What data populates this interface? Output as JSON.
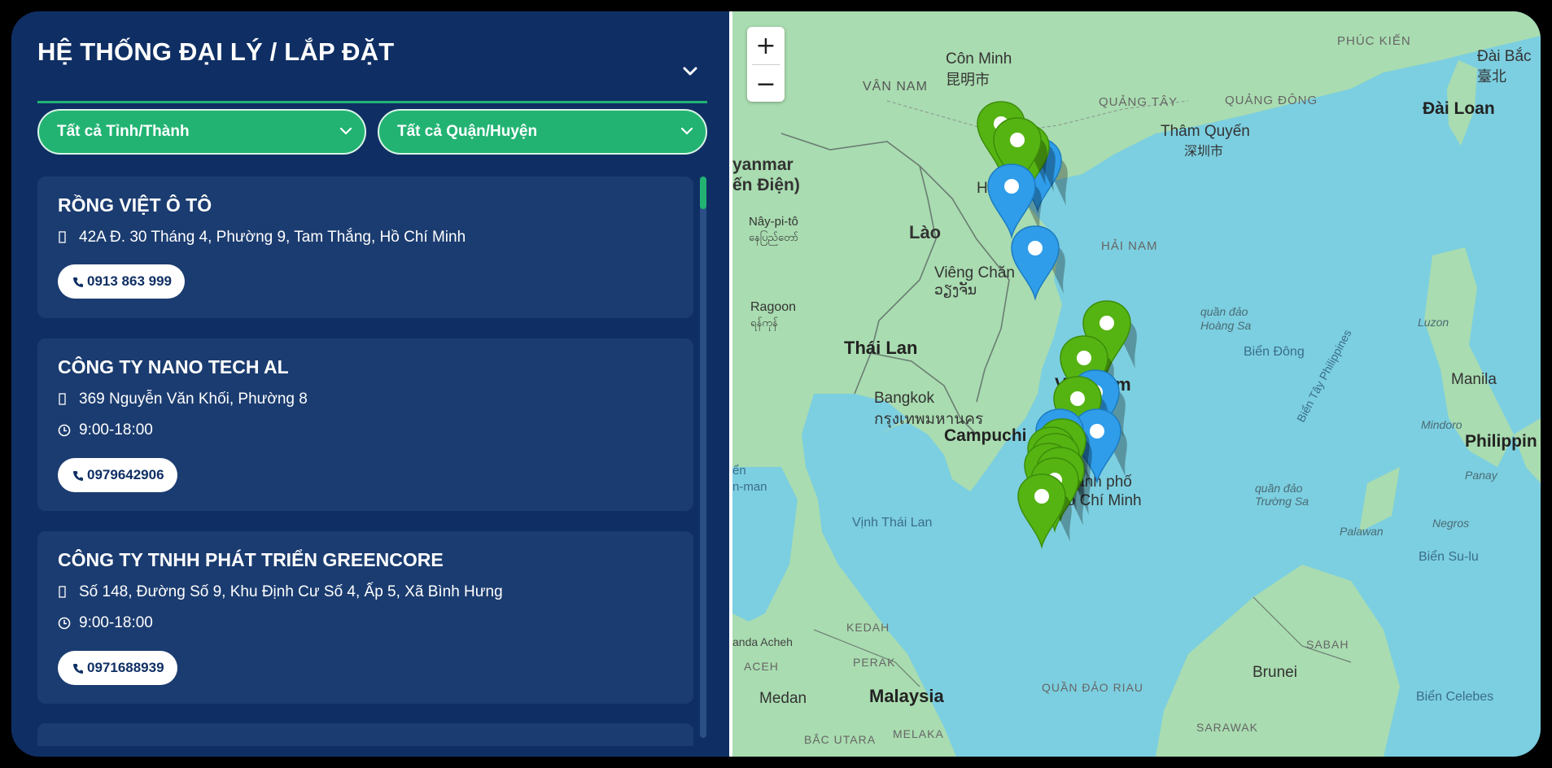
{
  "header": {
    "title": "HỆ THỐNG ĐẠI LÝ / LẮP ĐẶT"
  },
  "filters": {
    "province": "Tất cả Tỉnh/Thành",
    "district": "Tất cả Quận/Huyện"
  },
  "dealers": [
    {
      "name": "RỒNG VIỆT Ô TÔ",
      "address": "42A Đ. 30 Tháng 4, Phường 9, Tam Thắng, Hồ Chí Minh",
      "hours": "",
      "phone": "0913 863 999"
    },
    {
      "name": "CÔNG TY NANO TECH AL",
      "address": "369 Nguyễn Văn Khối, Phường 8",
      "hours": "9:00-18:00",
      "phone": "0979642906"
    },
    {
      "name": "CÔNG TY TNHH PHÁT TRIỂN GREENCORE",
      "address": "Số 148, Đường Số 9, Khu Định Cư Số 4, Ấp 5, Xã Bình Hưng",
      "hours": "9:00-18:00",
      "phone": "0971688939"
    }
  ],
  "map": {
    "zoom_in": "+",
    "zoom_out": "−",
    "labels": {
      "con_minh": "Côn Minh",
      "con_minh_cn": "昆明市",
      "van_nam": "VÂN NAM",
      "quang_tay": "QUẢNG TÂY",
      "quang_dong": "QUẢNG ĐÔNG",
      "phuc_kien": "PHÚC KIẾN",
      "dai_bac": "Đài Bắc",
      "dai_bac_cn": "臺北",
      "dai_loan": "Đài Loan",
      "tham_quyen": "Thâm Quyến",
      "tham_quyen_cn": "深圳市",
      "myanmar_a": "yanmar",
      "myanmar_b": "ến Điện)",
      "naypyito": "Nây-pi-tô",
      "naypyito_my": "နေပြည်တော်",
      "lao": "Lào",
      "ha_noi": "Hà Nội",
      "hai_nam": "HẢI NAM",
      "vientiane": "Viêng Chăn",
      "vientiane_lo": "ວຽງຈັນ",
      "ragoon": "Ragoon",
      "ragoon_my": "ရန်ကုန်",
      "hoang_sa_a": "quần đảo",
      "hoang_sa_b": "Hoàng Sa",
      "luzon": "Luzon",
      "thai_lan": "Thái Lan",
      "bien_dong": "Biển Đông",
      "vietnam": "Việt Nam",
      "bangkok": "Bangkok",
      "bangkok_th": "กรุงเทพมหานคร",
      "manila": "Manila",
      "campuchia": "Campuchia",
      "bien_tay": "Biển Tây Philippines",
      "mindoro": "Mindoro",
      "philippines": "Philippin",
      "hcm_a": "Thành phố",
      "hcm_b": "Hồ Chí Minh",
      "panay": "Panay",
      "n_man_a": "ển",
      "n_man_b": "n-man",
      "vinh_thai_lan": "Vịnh Thái Lan",
      "truong_sa_a": "quần đảo",
      "truong_sa_b": "Trường Sa",
      "negros": "Negros",
      "palawan": "Palawan",
      "bien_sulu": "Biển Su-lu",
      "banda_aceh": "anda Acheh",
      "kedah": "KEDAH",
      "sabah": "SABAH",
      "aceh": "ACEH",
      "perak": "PERAK",
      "brunei": "Brunei",
      "riau": "QUẦN ĐẢO RIAU",
      "medan": "Medan",
      "malaysia": "Malaysia",
      "bien_celebes": "Biển Celebes",
      "bac_utara": "BẮC UTARA",
      "melaka": "MELAKA",
      "sarawak": "SARAWAK"
    },
    "colors": {
      "water": "#7ccfe0",
      "land": "#a9dcb0",
      "pin_green": "#55b412",
      "pin_blue": "#2f9de9"
    }
  }
}
